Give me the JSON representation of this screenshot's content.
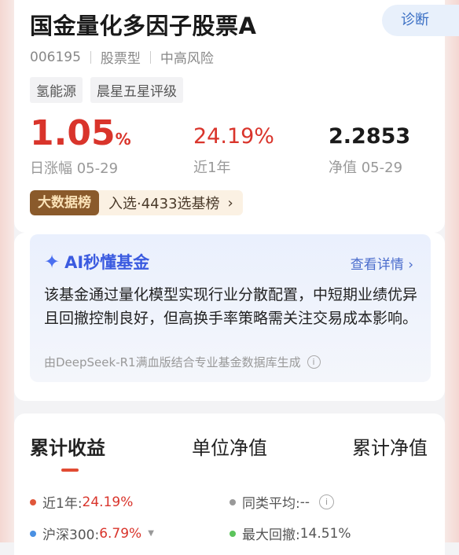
{
  "fund": {
    "name": "国金量化多因子股票A",
    "code": "006195",
    "type": "股票型",
    "risk": "中高风险",
    "tags": [
      "氢能源",
      "晨星五星评级"
    ],
    "diagnose_label": "诊断"
  },
  "stats": {
    "daily": {
      "value": "1.05",
      "unit": "%",
      "label": "日涨幅 05-29"
    },
    "year": {
      "value": "24.19%",
      "label": "近1年"
    },
    "nav": {
      "value": "2.2853",
      "label": "净值 05-29"
    }
  },
  "bigdata": {
    "badge": "大数据榜",
    "text": "入选·4433选基榜",
    "chevron": "›"
  },
  "ai": {
    "icon": "sparkle-icon",
    "title": "AI秒懂基金",
    "more": "查看详情 ›",
    "summary": "该基金通过量化模型实现行业分散配置，中短期业绩优异且回撤控制良好，但高换手率策略需关注交易成本影响。",
    "footer": "由DeepSeek-R1满血版结合专业基金数据库生成",
    "info": "i"
  },
  "performance": {
    "tabs": [
      "累计收益",
      "单位净值",
      "累计净值"
    ],
    "active_tab": "累计收益",
    "legend": [
      {
        "label": "近1年:",
        "value": "24.19%",
        "color": "#e0573a"
      },
      {
        "label": "同类平均:",
        "value": "--",
        "color": "#999999"
      },
      {
        "label": "沪深300:",
        "value": "6.79%",
        "color": "#4a90e2"
      },
      {
        "label": "最大回撤:",
        "value": "14.51%",
        "color": "#5cc45c"
      }
    ]
  }
}
